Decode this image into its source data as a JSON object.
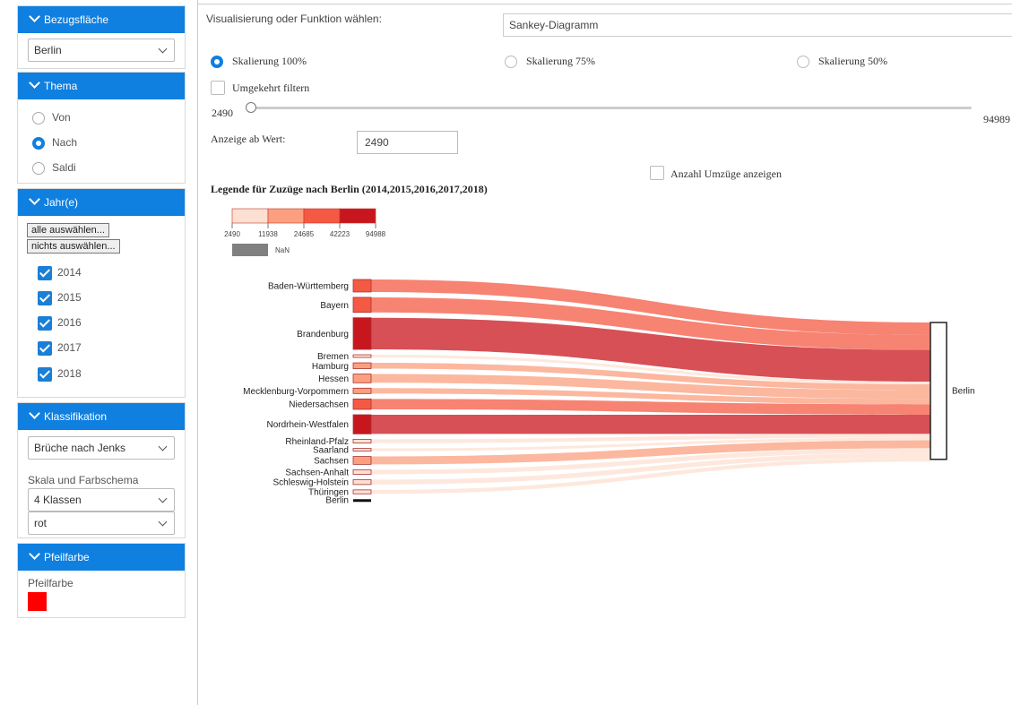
{
  "sidebar": {
    "bezug": {
      "title": "Bezugsfläche",
      "selected": "Berlin"
    },
    "thema": {
      "title": "Thema",
      "options": [
        "Von",
        "Nach",
        "Saldi"
      ],
      "selected": "Nach"
    },
    "jahre": {
      "title": "Jahr(e)",
      "select_all": "alle auswählen...",
      "select_none": "nichts auswählen...",
      "years": [
        "2014",
        "2015",
        "2016",
        "2017",
        "2018"
      ],
      "checked": [
        true,
        true,
        true,
        true,
        true
      ]
    },
    "klass": {
      "title": "Klassifikation",
      "method": "Brüche nach Jenks",
      "scale_label": "Skala und Farbschema",
      "classes": "4 Klassen",
      "scheme": "rot"
    },
    "pfeil": {
      "title": "Pfeilfarbe",
      "label": "Pfeilfarbe",
      "color": "#ff0000"
    }
  },
  "main": {
    "vis_label": "Visualisierung oder Funktion wählen:",
    "vis_value": "Sankey-Diagramm",
    "scaling": {
      "options": [
        "Skalierung 100%",
        "Skalierung 75%",
        "Skalierung 50%"
      ],
      "selected": "Skalierung 100%"
    },
    "invert_label": "Umgekehrt filtern",
    "slider": {
      "min": "2490",
      "max": "94989",
      "value": 2490
    },
    "threshold_label": "Anzeige ab Wert:",
    "threshold_value": "2490",
    "show_count_label": "Anzahl Umzüge anzeigen",
    "legend_title": "Legende für Zuzüge nach Berlin (2014,2015,2016,2017,2018)",
    "legend": {
      "breaks": [
        "2490",
        "11938",
        "24685",
        "42223",
        "94988"
      ],
      "colors": [
        "#fde0d2",
        "#fb9f7f",
        "#f45a43",
        "#c8161e"
      ],
      "nan_label": "NaN",
      "nan_color": "#808080"
    }
  },
  "chart_data": {
    "type": "sankey",
    "target": "Berlin",
    "nodes": [
      {
        "name": "Baden-Württemberg",
        "value": 30000
      },
      {
        "name": "Bayern",
        "value": 36000
      },
      {
        "name": "Brandenburg",
        "value": 76000
      },
      {
        "name": "Bremen",
        "value": 5000
      },
      {
        "name": "Hamburg",
        "value": 14000
      },
      {
        "name": "Hessen",
        "value": 21000
      },
      {
        "name": "Mecklenburg-Vorpommern",
        "value": 13000
      },
      {
        "name": "Niedersachsen",
        "value": 25000
      },
      {
        "name": "Nordrhein-Westfalen",
        "value": 46000
      },
      {
        "name": "Rheinland-Pfalz",
        "value": 9000
      },
      {
        "name": "Saarland",
        "value": 2490
      },
      {
        "name": "Sachsen",
        "value": 19000
      },
      {
        "name": "Sachsen-Anhalt",
        "value": 11000
      },
      {
        "name": "Schleswig-Holstein",
        "value": 11500
      },
      {
        "name": "Thüringen",
        "value": 9500
      },
      {
        "name": "Berlin",
        "value": 0
      }
    ]
  }
}
